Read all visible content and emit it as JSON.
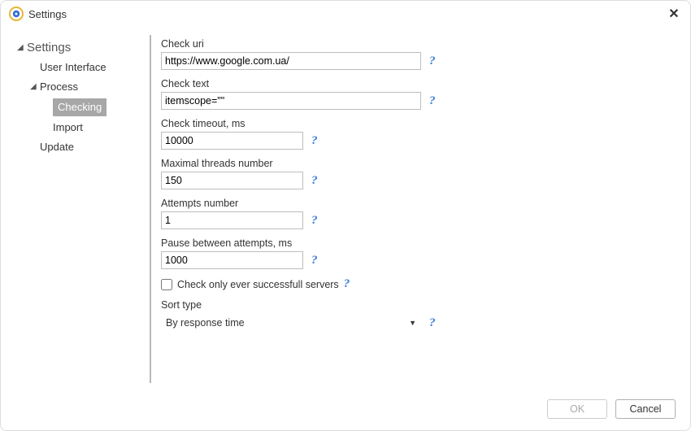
{
  "window": {
    "title": "Settings"
  },
  "sidebar": {
    "root": "Settings",
    "items": [
      {
        "label": "User Interface"
      },
      {
        "label": "Process",
        "children": [
          {
            "label": "Checking",
            "selected": true
          },
          {
            "label": "Import"
          }
        ]
      },
      {
        "label": "Update"
      }
    ]
  },
  "fields": {
    "check_uri": {
      "label": "Check uri",
      "value": "https://www.google.com.ua/"
    },
    "check_text": {
      "label": "Check text",
      "value": "itemscope=\"\""
    },
    "check_timeout": {
      "label": "Check timeout, ms",
      "value": "10000"
    },
    "max_threads": {
      "label": "Maximal threads number",
      "value": "150"
    },
    "attempts": {
      "label": "Attempts number",
      "value": "1"
    },
    "pause": {
      "label": "Pause between attempts, ms",
      "value": "1000"
    },
    "check_only_successful": {
      "label": "Check only ever successfull servers",
      "checked": false
    },
    "sort_type": {
      "label": "Sort type",
      "value": "By response time"
    }
  },
  "buttons": {
    "ok": "OK",
    "cancel": "Cancel"
  },
  "help_glyph": "?"
}
